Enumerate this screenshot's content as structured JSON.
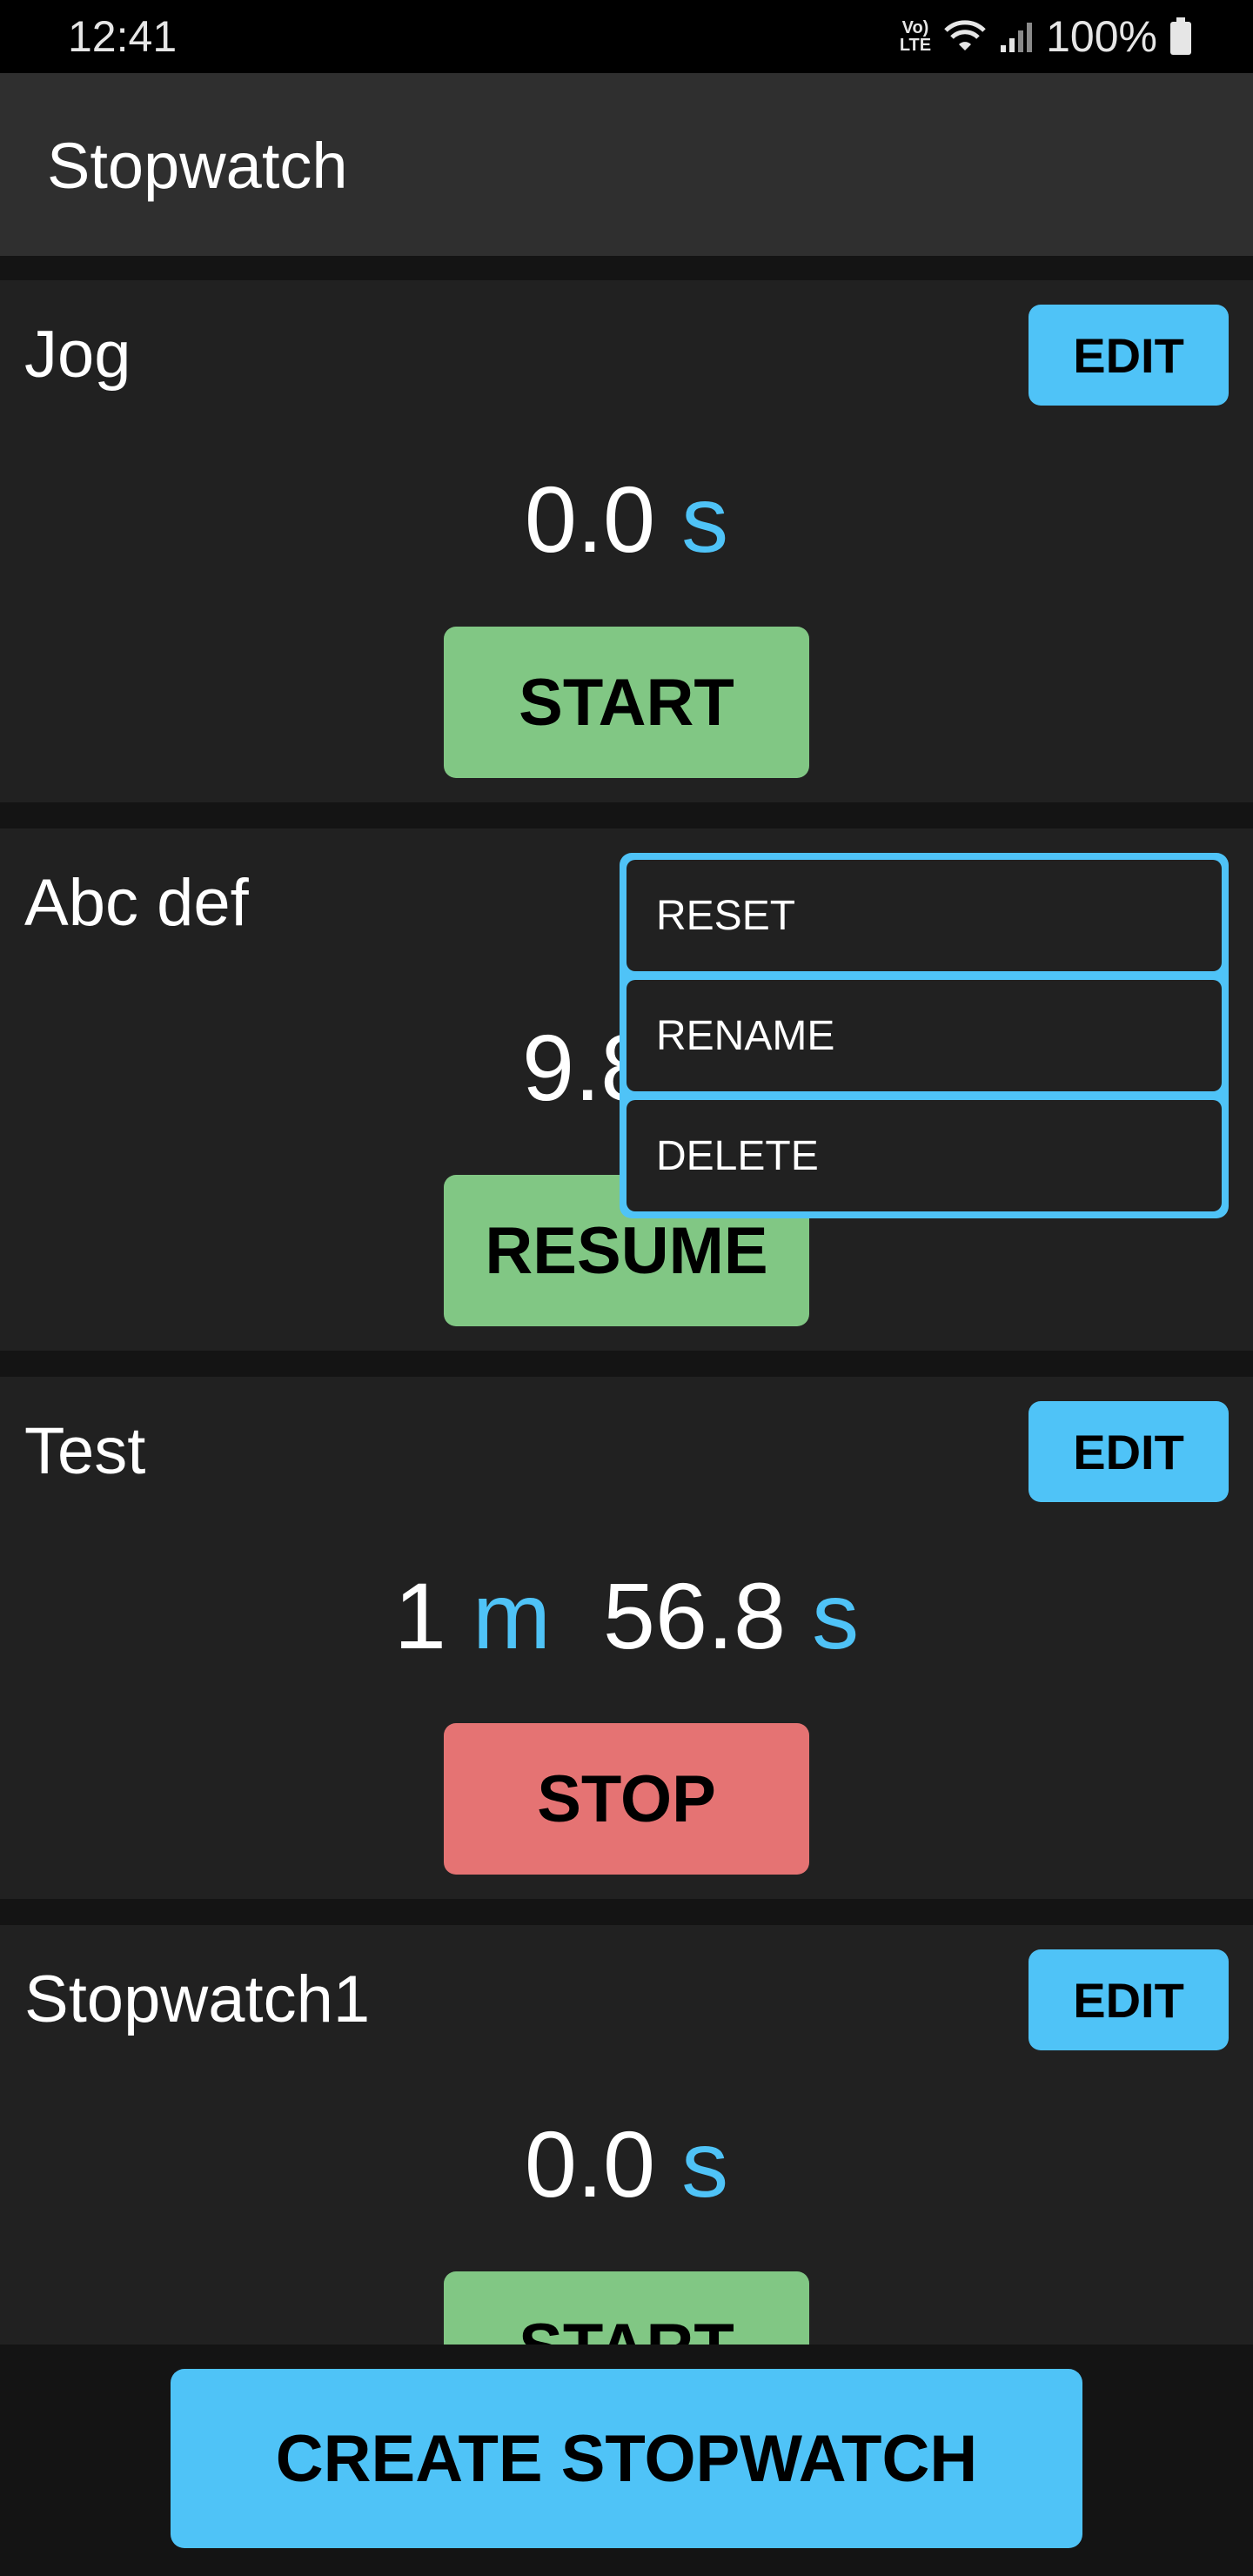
{
  "status_bar": {
    "time": "12:41",
    "volte_line1": "Vo)",
    "volte_line2": "LTE",
    "battery": "100%",
    "icons": [
      "volte-icon",
      "wifi-icon",
      "signal-icon",
      "battery-icon"
    ]
  },
  "app_bar": {
    "title": "Stopwatch"
  },
  "stopwatches": [
    {
      "name": "Jog",
      "edit_label": "EDIT",
      "seconds": "0.0",
      "seconds_unit": "s",
      "action_label": "START",
      "action_color": "#81c784"
    },
    {
      "name": "Abc def",
      "seconds_partial": "9.8",
      "action_label": "RESUME",
      "action_color": "#81c784"
    },
    {
      "name": "Test",
      "edit_label": "EDIT",
      "minutes": "1",
      "minutes_unit": "m",
      "seconds": "56.8",
      "seconds_unit": "s",
      "action_label": "STOP",
      "action_color": "#e57373"
    },
    {
      "name": "Stopwatch1",
      "edit_label": "EDIT",
      "seconds": "0.0",
      "seconds_unit": "s",
      "action_label": "START",
      "action_color": "#81c784"
    }
  ],
  "popup_menu": {
    "items": [
      "RESET",
      "RENAME",
      "DELETE"
    ]
  },
  "create_button_label": "CREATE STOPWATCH",
  "colors": {
    "accent": "#4fc3f7",
    "start_green": "#81c784",
    "stop_red": "#e57373",
    "card_background": "#212121",
    "app_bar": "#2f2f2f"
  }
}
